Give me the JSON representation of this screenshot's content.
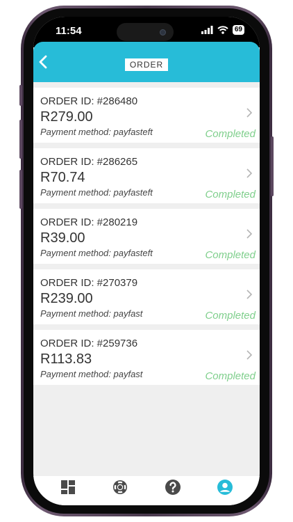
{
  "status_bar": {
    "time": "11:54",
    "battery": "69"
  },
  "header": {
    "title": "ORDER"
  },
  "orders": [
    {
      "order_id": "ORDER ID: #286480",
      "amount": "R279.00",
      "payment": "Payment method: payfasteft",
      "status": "Completed"
    },
    {
      "order_id": "ORDER ID: #286265",
      "amount": "R70.74",
      "payment": "Payment method: payfasteft",
      "status": "Completed"
    },
    {
      "order_id": "ORDER ID: #280219",
      "amount": "R39.00",
      "payment": "Payment method: payfasteft",
      "status": "Completed"
    },
    {
      "order_id": "ORDER ID: #270379",
      "amount": "R239.00",
      "payment": "Payment method: payfast",
      "status": "Completed"
    },
    {
      "order_id": "ORDER ID: #259736",
      "amount": "R113.83",
      "payment": "Payment method: payfast",
      "status": "Completed"
    }
  ],
  "tabs": [
    {
      "icon": "dashboard-icon"
    },
    {
      "icon": "support-lifebuoy-icon"
    },
    {
      "icon": "help-icon"
    },
    {
      "icon": "account-icon",
      "active": true
    }
  ],
  "colors": {
    "accent": "#27bcd8",
    "status_completed": "#7fcf8c",
    "tab_inactive": "#4a4a4a"
  }
}
